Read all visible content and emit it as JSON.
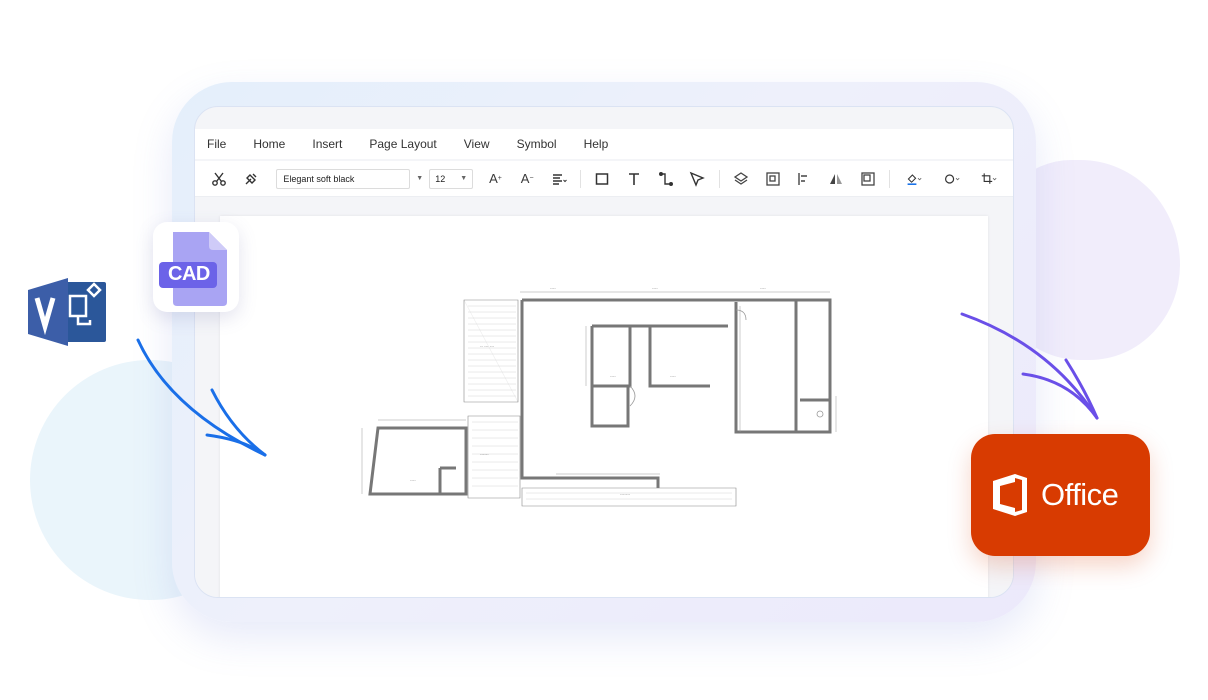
{
  "menu": [
    "File",
    "Home",
    "Insert",
    "Page Layout",
    "View",
    "Symbol",
    "Help"
  ],
  "toolbar": {
    "font_name": "Elegant soft black",
    "font_size": "12",
    "tools_left": [
      "cut-icon",
      "format-painter-icon"
    ],
    "tools_text": [
      "increase-font-icon",
      "decrease-font-icon",
      "align-icon"
    ],
    "tools_shapes": [
      "rectangle-icon",
      "text-icon",
      "connector-icon",
      "pointer-icon"
    ],
    "tools_arrange": [
      "layers-icon",
      "group-icon",
      "align-left-icon",
      "flip-icon",
      "position-icon"
    ],
    "tools_style": [
      "fill-icon",
      "line-icon",
      "crop-icon"
    ],
    "fill_accent": "#1a73e8"
  },
  "badges": {
    "cad_label": "CAD",
    "office_label": "Office"
  },
  "colors": {
    "visio_blue": "#2b579a",
    "cad_purple": "#7b6fe8",
    "office_orange": "#d83b01",
    "arrow_blue": "#1a6fe8",
    "arrow_purple": "#6a4fe8"
  }
}
